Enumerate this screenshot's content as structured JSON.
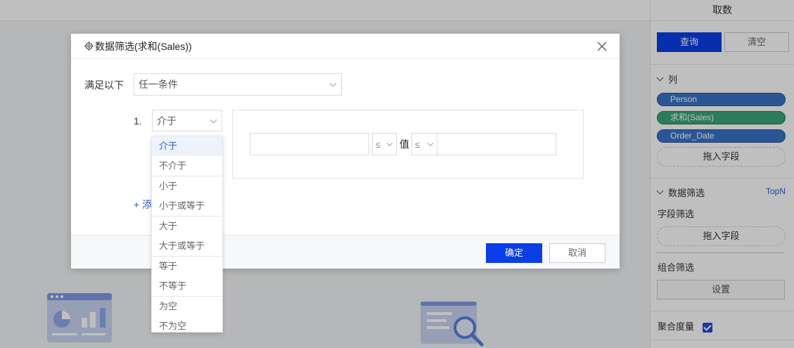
{
  "right_panel": {
    "header": "取数",
    "query_button": "查询",
    "clear_button": "清空",
    "columns_section": "列",
    "column_pills": [
      "Person",
      "求和(Sales)",
      "Order_Date"
    ],
    "drop_field_label": "拖入字段",
    "data_filter_section": "数据筛选",
    "topn_link": "TopN",
    "field_filter_label": "字段筛选",
    "drop_field_label_2": "拖入字段",
    "combo_filter_label": "组合筛选",
    "settings_button": "设置",
    "aggregate_measure_label": "聚合度量",
    "aggregate_measure_checked": true
  },
  "dialog": {
    "title": "数据筛选(求和(Sales))",
    "satisfy_label": "满足以下",
    "condition_mode": "任一条件",
    "condition_index": "1.",
    "operator_selected": "介于",
    "op_left": "≤",
    "value_label": "值",
    "op_right": "≤",
    "add_link": "+ 添",
    "ok_button": "确定",
    "cancel_button": "取消"
  },
  "dropdown": {
    "groups": [
      [
        "介于",
        "不介于"
      ],
      [
        "小于",
        "小于或等于"
      ],
      [
        "大于",
        "大于或等于"
      ],
      [
        "等于",
        "不等于"
      ],
      [
        "为空",
        "不为空"
      ]
    ],
    "selected": "介于"
  },
  "colors": {
    "primary": "#0a3ee6",
    "pill_blue": "#3a73c9",
    "pill_green": "#3aa57d",
    "link": "#2a5bd7"
  }
}
